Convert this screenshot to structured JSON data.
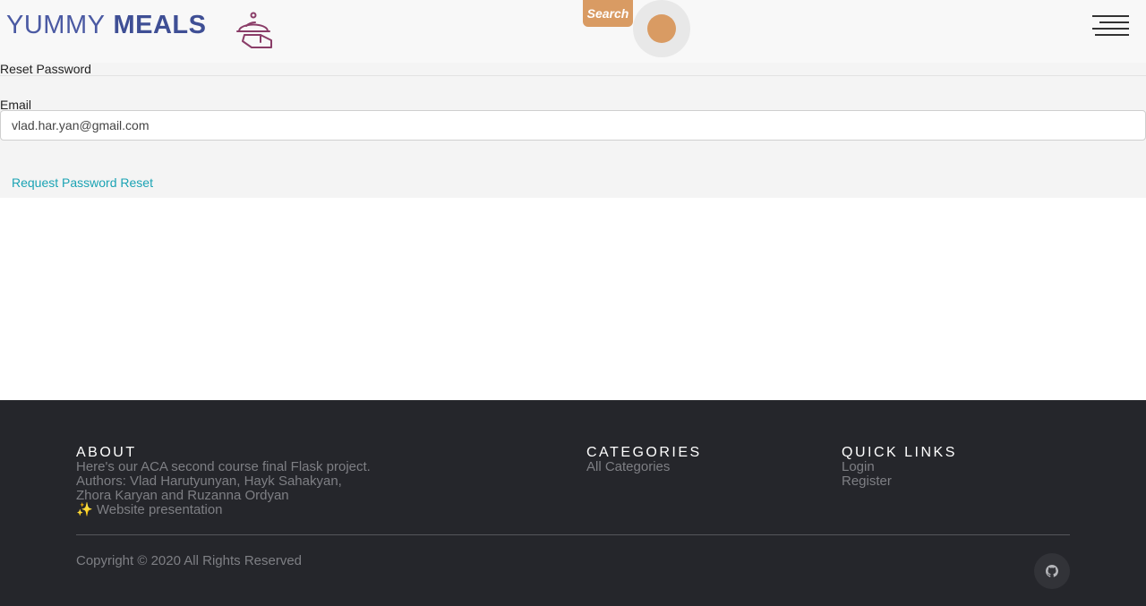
{
  "header": {
    "logo_word1": "YUMMY",
    "logo_word2": "MEALS",
    "logo_icon": "serving-cloche-icon",
    "search_label": "Search",
    "menu_icon": "hamburger-menu-icon"
  },
  "form": {
    "title": "Reset Password",
    "email_label": "Email",
    "email_value": "vlad.har.yan@gmail.com",
    "submit_label": "Request Password Reset"
  },
  "footer": {
    "about": {
      "heading": "ABOUT",
      "line1": "Here's our ACA second course final Flask project.",
      "line2": "Authors: Vlad Harutyunyan, Hayk Sahakyan,",
      "line3": "Zhora Karyan and Ruzanna Ordyan",
      "presentation_icon": "✨",
      "presentation_label": "Website presentation"
    },
    "categories": {
      "heading": "CATEGORIES",
      "links": [
        "All Categories"
      ]
    },
    "quick_links": {
      "heading": "QUICK LINKS",
      "links": [
        "Login",
        "Register"
      ]
    },
    "copyright": "Copyright © 2020 All Rights Reserved",
    "social_icon": "github-icon"
  },
  "colors": {
    "brand": "#4b5aa3",
    "accent": "#d99b63",
    "link": "#1ba3b4",
    "footer_bg": "#25262b"
  }
}
